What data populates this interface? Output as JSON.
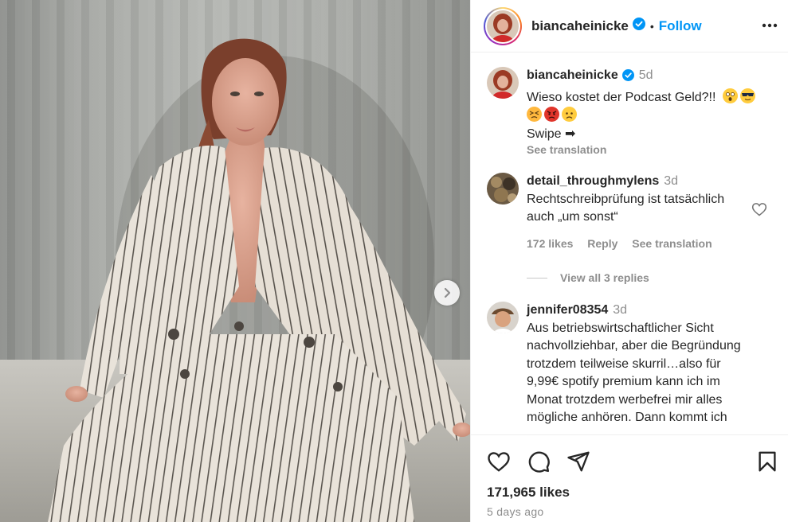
{
  "header": {
    "username": "biancaheinicke",
    "separator": "•",
    "follow_label": "Follow"
  },
  "caption": {
    "username": "biancaheinicke",
    "time": "5d",
    "text": "Wieso kostet der Podcast Geld?!!",
    "swipe_text": "Swipe ➡",
    "see_translation": "See translation",
    "emojis": [
      "astonished-face",
      "sunglasses-face",
      "persevering-face",
      "angry-face",
      "worried-face"
    ]
  },
  "comments": [
    {
      "username": "detail_throughmylens",
      "time": "3d",
      "text": "Rechtschreibprüfung ist tatsächlich auch „um sonst“",
      "likes": "172 likes",
      "reply": "Reply",
      "see_translation": "See translation"
    },
    {
      "username": "jennifer08354",
      "time": "3d",
      "text": "Aus betriebswirtschaftlicher Sicht nachvollziehbar, aber die Begründung trotzdem teilweise skurril…also für 9,99€ spotify premium kann ich im Monat trotzdem werbefrei mir alles mögliche anhören. Dann kommt ich"
    }
  ],
  "view_replies": "View all 3 replies",
  "footer": {
    "likes": "171,965 likes",
    "posted": "5 days ago"
  },
  "colors": {
    "accent": "#0095f6",
    "muted": "#8e8e8e",
    "text": "#262626",
    "verified": "#0095f6"
  }
}
